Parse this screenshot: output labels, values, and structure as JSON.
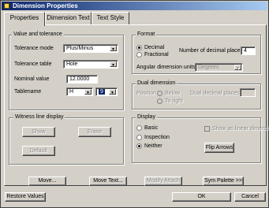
{
  "window": {
    "title": "Dimension Properties"
  },
  "tabs": [
    "Properties",
    "Dimension Text",
    "Text Style"
  ],
  "value_tolerance": {
    "group_label": "Value and tolerance",
    "tolerance_mode_label": "Tolerance mode",
    "tolerance_mode_value": "Plus/Minus",
    "tolerance_table_label": "Tolerance table",
    "tolerance_table_value": "Hole",
    "nominal_value_label": "Nominal value",
    "nominal_value": "12.0000",
    "tablename_label": "Tablename",
    "tablename_value1": "H",
    "tablename_value2": "9"
  },
  "format": {
    "group_label": "Format",
    "decimal_label": "Decimal",
    "fractional_label": "Fractional",
    "selected": "Decimal",
    "decimal_places_label": "Number of decimal places",
    "decimal_places_value": "4",
    "angular_units_label": "Angular dimension units",
    "angular_units_value": "Degrees"
  },
  "dual": {
    "group_label": "Dual dimension",
    "position_label": "Position",
    "below_label": "Below",
    "to_right_label": "To right",
    "dual_decimal_label": "Dual decimal places"
  },
  "witness": {
    "group_label": "Witness line display",
    "show_label": "Show",
    "erase_label": "Erase",
    "default_label": "Default"
  },
  "display": {
    "group_label": "Display",
    "basic_label": "Basic",
    "inspection_label": "Inspection",
    "neither_label": "Neither",
    "selected": "Neither",
    "show_as_linear_label": "Show as linear dimension",
    "flip_arrows_label": "Flip Arrows"
  },
  "buttons": {
    "move": "Move...",
    "move_text": "Move Text...",
    "modify_attach": "Modify Attach",
    "sym_palette": "Sym Palette >>",
    "restore_values": "Restore Values",
    "ok": "OK",
    "cancel": "Cancel"
  }
}
